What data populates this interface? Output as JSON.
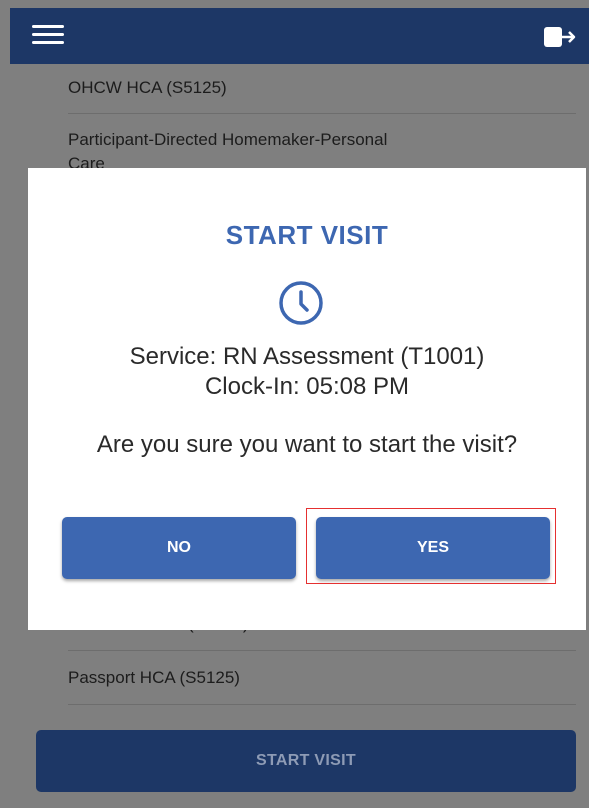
{
  "header": {
    "menu_icon": "hamburger-menu-icon",
    "logout_icon": "logout-icon"
  },
  "services": {
    "items": [
      "OHCW HCA (S5125)",
      "Participant-Directed Homemaker-Personal Care",
      "Passport HCA (S5125)"
    ],
    "partially_visible": "(S5125)"
  },
  "modal": {
    "title": "START VISIT",
    "icon": "clock-icon",
    "service_line": "Service: RN Assessment (T1001)",
    "clock_in_line": "Clock-In: 05:08 PM",
    "question": "Are you sure you want to start the visit?",
    "no_label": "NO",
    "yes_label": "YES"
  },
  "bottom_button": {
    "label": "START VISIT"
  },
  "colors": {
    "header": "#1d3766",
    "accent": "#3d67b1",
    "overlay": "#7f7f7f",
    "highlight": "#e53030"
  }
}
